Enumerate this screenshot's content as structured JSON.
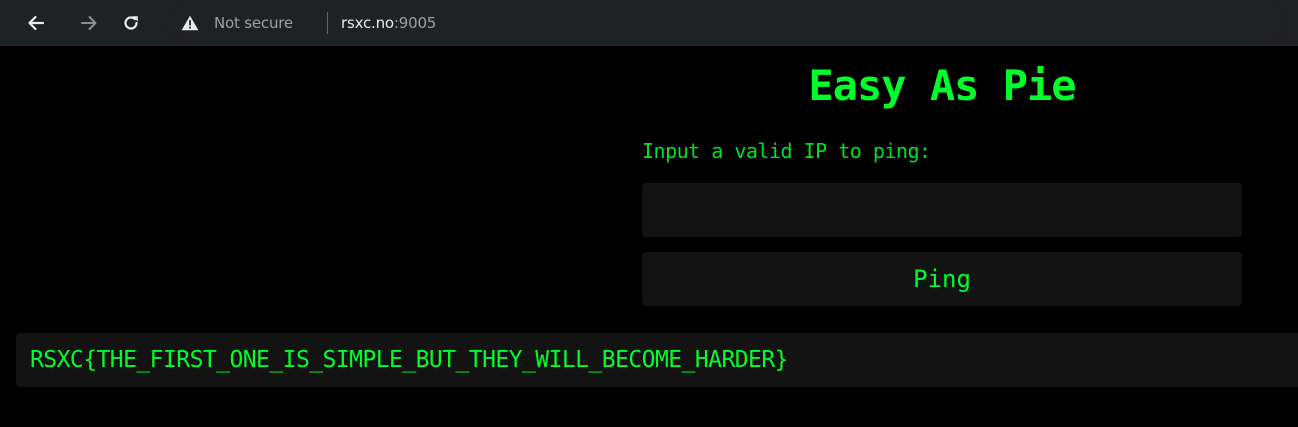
{
  "browser": {
    "back_icon": "arrow-left-icon",
    "forward_icon": "arrow-right-icon",
    "reload_icon": "reload-icon",
    "security_icon": "warning-triangle-icon",
    "security_label": "Not secure",
    "url_host": "rsxc.no",
    "url_port": ":9005"
  },
  "page": {
    "title": "Easy As Pie",
    "prompt": "Input a valid IP to ping:",
    "ip_value": "",
    "ping_label": "Ping",
    "output": "RSXC{THE_FIRST_ONE_IS_SIMPLE_BUT_THEY_WILL_BECOME_HARDER}"
  },
  "colors": {
    "accent_green": "#00ff2a",
    "page_background": "#000000",
    "field_background": "#131313",
    "toolbar_background": "#202124"
  }
}
